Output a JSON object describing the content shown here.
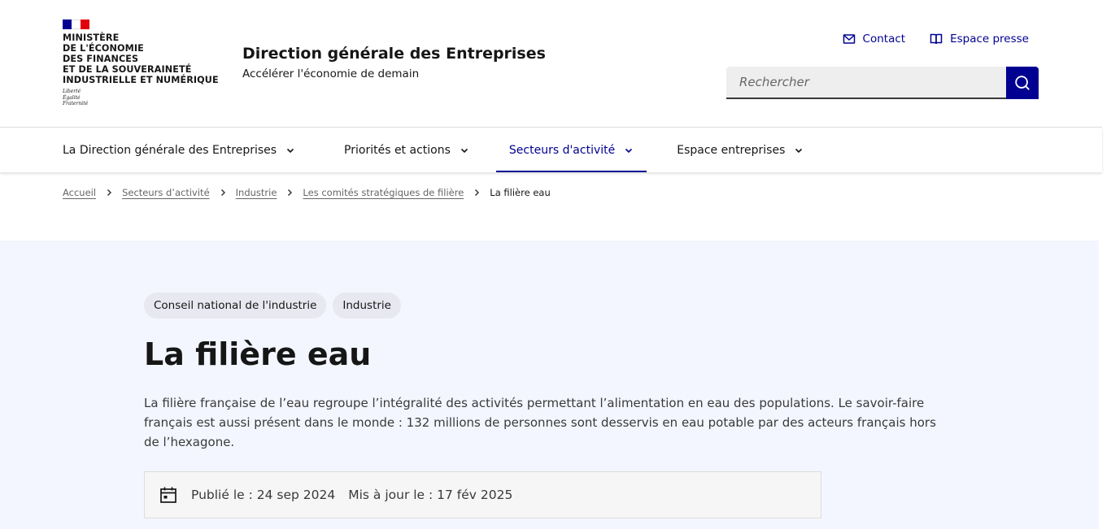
{
  "header": {
    "ministry": "Ministère\nde l'économie\ndes finances\net de la souveraineté\nindustrielle et numérique",
    "devise": "Liberté\nÉgalité\nFraternité",
    "service_title": "Direction générale des Entreprises",
    "service_tagline": "Accélérer l'économie de demain",
    "tools": [
      {
        "label": "Contact",
        "icon": "mail-icon"
      },
      {
        "label": "Espace presse",
        "icon": "book-icon"
      }
    ],
    "search": {
      "placeholder": "Rechercher",
      "button_icon": "search-icon"
    }
  },
  "nav": {
    "items": [
      {
        "label": "La Direction générale des Entreprises",
        "active": false
      },
      {
        "label": "Priorités et actions",
        "active": false
      },
      {
        "label": "Secteurs d'activité",
        "active": true
      },
      {
        "label": "Espace entreprises",
        "active": false
      }
    ]
  },
  "breadcrumb": {
    "links": [
      "Accueil",
      "Secteurs d’activité",
      "Industrie",
      "Les comités stratégiques de filière"
    ],
    "current": "La filière eau"
  },
  "hero": {
    "tags": [
      "Conseil national de l'industrie",
      "Industrie"
    ],
    "title": "La filière eau",
    "lead": "La filière française de l’eau regroupe l’intégralité des activités permettant l’alimentation en eau des populations. Le savoir-faire français est aussi présent dans le monde : 132 millions de personnes sont desservis en eau potable par des acteurs français hors de l’hexagone.",
    "published": "Publié le : 24 sep 2024",
    "updated": "Mis à jour le : 17 fév 2025"
  },
  "colors": {
    "primary": "#000091",
    "flag_blue": "#000091",
    "flag_red": "#e1000f",
    "hero_bg": "#f3f6fe"
  }
}
